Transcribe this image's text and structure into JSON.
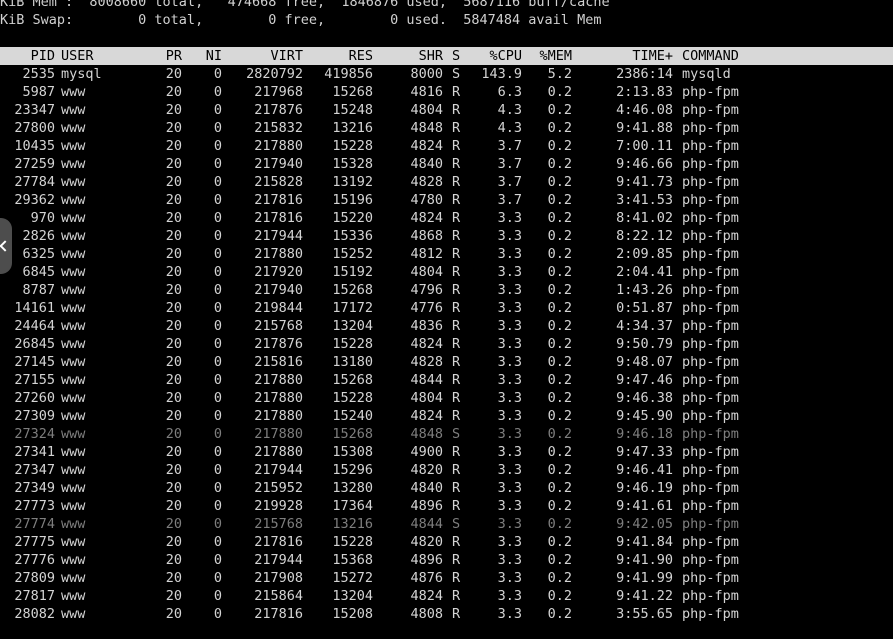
{
  "summary": {
    "mem_line": "KiB Mem :  8008660 total,   474668 free,  1846876 used,  5687116 buff/cache",
    "swap_line": "KiB Swap:        0 total,        0 free,        0 used.  5847484 avail Mem"
  },
  "columns": {
    "pid": "PID",
    "user": "USER",
    "pr": "PR",
    "ni": "NI",
    "virt": "VIRT",
    "res": "RES",
    "shr": "SHR",
    "s": "S",
    "cpu": "%CPU",
    "mem": "%MEM",
    "time": "TIME+",
    "command": "COMMAND"
  },
  "processes": [
    {
      "pid": "2535",
      "user": "mysql",
      "pr": "20",
      "ni": "0",
      "virt": "2820792",
      "res": "419856",
      "shr": "8000",
      "s": "S",
      "cpu": "143.9",
      "mem": "5.2",
      "time": "2386:14",
      "command": "mysqld",
      "dim": false
    },
    {
      "pid": "5987",
      "user": "www",
      "pr": "20",
      "ni": "0",
      "virt": "217968",
      "res": "15268",
      "shr": "4816",
      "s": "R",
      "cpu": "6.3",
      "mem": "0.2",
      "time": "2:13.83",
      "command": "php-fpm",
      "dim": false
    },
    {
      "pid": "23347",
      "user": "www",
      "pr": "20",
      "ni": "0",
      "virt": "217876",
      "res": "15248",
      "shr": "4804",
      "s": "R",
      "cpu": "4.3",
      "mem": "0.2",
      "time": "4:46.08",
      "command": "php-fpm",
      "dim": false
    },
    {
      "pid": "27800",
      "user": "www",
      "pr": "20",
      "ni": "0",
      "virt": "215832",
      "res": "13216",
      "shr": "4848",
      "s": "R",
      "cpu": "4.3",
      "mem": "0.2",
      "time": "9:41.88",
      "command": "php-fpm",
      "dim": false
    },
    {
      "pid": "10435",
      "user": "www",
      "pr": "20",
      "ni": "0",
      "virt": "217880",
      "res": "15228",
      "shr": "4824",
      "s": "R",
      "cpu": "3.7",
      "mem": "0.2",
      "time": "7:00.11",
      "command": "php-fpm",
      "dim": false
    },
    {
      "pid": "27259",
      "user": "www",
      "pr": "20",
      "ni": "0",
      "virt": "217940",
      "res": "15328",
      "shr": "4840",
      "s": "R",
      "cpu": "3.7",
      "mem": "0.2",
      "time": "9:46.66",
      "command": "php-fpm",
      "dim": false
    },
    {
      "pid": "27784",
      "user": "www",
      "pr": "20",
      "ni": "0",
      "virt": "215828",
      "res": "13192",
      "shr": "4828",
      "s": "R",
      "cpu": "3.7",
      "mem": "0.2",
      "time": "9:41.73",
      "command": "php-fpm",
      "dim": false
    },
    {
      "pid": "29362",
      "user": "www",
      "pr": "20",
      "ni": "0",
      "virt": "217816",
      "res": "15196",
      "shr": "4780",
      "s": "R",
      "cpu": "3.7",
      "mem": "0.2",
      "time": "3:41.53",
      "command": "php-fpm",
      "dim": false
    },
    {
      "pid": "970",
      "user": "www",
      "pr": "20",
      "ni": "0",
      "virt": "217816",
      "res": "15220",
      "shr": "4824",
      "s": "R",
      "cpu": "3.3",
      "mem": "0.2",
      "time": "8:41.02",
      "command": "php-fpm",
      "dim": false
    },
    {
      "pid": "2826",
      "user": "www",
      "pr": "20",
      "ni": "0",
      "virt": "217944",
      "res": "15336",
      "shr": "4868",
      "s": "R",
      "cpu": "3.3",
      "mem": "0.2",
      "time": "8:22.12",
      "command": "php-fpm",
      "dim": false
    },
    {
      "pid": "6325",
      "user": "www",
      "pr": "20",
      "ni": "0",
      "virt": "217880",
      "res": "15252",
      "shr": "4812",
      "s": "R",
      "cpu": "3.3",
      "mem": "0.2",
      "time": "2:09.85",
      "command": "php-fpm",
      "dim": false
    },
    {
      "pid": "6845",
      "user": "www",
      "pr": "20",
      "ni": "0",
      "virt": "217920",
      "res": "15192",
      "shr": "4804",
      "s": "R",
      "cpu": "3.3",
      "mem": "0.2",
      "time": "2:04.41",
      "command": "php-fpm",
      "dim": false
    },
    {
      "pid": "8787",
      "user": "www",
      "pr": "20",
      "ni": "0",
      "virt": "217940",
      "res": "15268",
      "shr": "4796",
      "s": "R",
      "cpu": "3.3",
      "mem": "0.2",
      "time": "1:43.26",
      "command": "php-fpm",
      "dim": false
    },
    {
      "pid": "14161",
      "user": "www",
      "pr": "20",
      "ni": "0",
      "virt": "219844",
      "res": "17172",
      "shr": "4776",
      "s": "R",
      "cpu": "3.3",
      "mem": "0.2",
      "time": "0:51.87",
      "command": "php-fpm",
      "dim": false
    },
    {
      "pid": "24464",
      "user": "www",
      "pr": "20",
      "ni": "0",
      "virt": "215768",
      "res": "13204",
      "shr": "4836",
      "s": "R",
      "cpu": "3.3",
      "mem": "0.2",
      "time": "4:34.37",
      "command": "php-fpm",
      "dim": false
    },
    {
      "pid": "26845",
      "user": "www",
      "pr": "20",
      "ni": "0",
      "virt": "217876",
      "res": "15228",
      "shr": "4824",
      "s": "R",
      "cpu": "3.3",
      "mem": "0.2",
      "time": "9:50.79",
      "command": "php-fpm",
      "dim": false
    },
    {
      "pid": "27145",
      "user": "www",
      "pr": "20",
      "ni": "0",
      "virt": "215816",
      "res": "13180",
      "shr": "4828",
      "s": "R",
      "cpu": "3.3",
      "mem": "0.2",
      "time": "9:48.07",
      "command": "php-fpm",
      "dim": false
    },
    {
      "pid": "27155",
      "user": "www",
      "pr": "20",
      "ni": "0",
      "virt": "217880",
      "res": "15268",
      "shr": "4844",
      "s": "R",
      "cpu": "3.3",
      "mem": "0.2",
      "time": "9:47.46",
      "command": "php-fpm",
      "dim": false
    },
    {
      "pid": "27260",
      "user": "www",
      "pr": "20",
      "ni": "0",
      "virt": "217880",
      "res": "15228",
      "shr": "4804",
      "s": "R",
      "cpu": "3.3",
      "mem": "0.2",
      "time": "9:46.38",
      "command": "php-fpm",
      "dim": false
    },
    {
      "pid": "27309",
      "user": "www",
      "pr": "20",
      "ni": "0",
      "virt": "217880",
      "res": "15240",
      "shr": "4824",
      "s": "R",
      "cpu": "3.3",
      "mem": "0.2",
      "time": "9:45.90",
      "command": "php-fpm",
      "dim": false
    },
    {
      "pid": "27324",
      "user": "www",
      "pr": "20",
      "ni": "0",
      "virt": "217880",
      "res": "15268",
      "shr": "4848",
      "s": "S",
      "cpu": "3.3",
      "mem": "0.2",
      "time": "9:46.18",
      "command": "php-fpm",
      "dim": true
    },
    {
      "pid": "27341",
      "user": "www",
      "pr": "20",
      "ni": "0",
      "virt": "217880",
      "res": "15308",
      "shr": "4900",
      "s": "R",
      "cpu": "3.3",
      "mem": "0.2",
      "time": "9:47.33",
      "command": "php-fpm",
      "dim": false
    },
    {
      "pid": "27347",
      "user": "www",
      "pr": "20",
      "ni": "0",
      "virt": "217944",
      "res": "15296",
      "shr": "4820",
      "s": "R",
      "cpu": "3.3",
      "mem": "0.2",
      "time": "9:46.41",
      "command": "php-fpm",
      "dim": false
    },
    {
      "pid": "27349",
      "user": "www",
      "pr": "20",
      "ni": "0",
      "virt": "215952",
      "res": "13280",
      "shr": "4840",
      "s": "R",
      "cpu": "3.3",
      "mem": "0.2",
      "time": "9:46.19",
      "command": "php-fpm",
      "dim": false
    },
    {
      "pid": "27773",
      "user": "www",
      "pr": "20",
      "ni": "0",
      "virt": "219928",
      "res": "17364",
      "shr": "4896",
      "s": "R",
      "cpu": "3.3",
      "mem": "0.2",
      "time": "9:41.61",
      "command": "php-fpm",
      "dim": false
    },
    {
      "pid": "27774",
      "user": "www",
      "pr": "20",
      "ni": "0",
      "virt": "215768",
      "res": "13216",
      "shr": "4844",
      "s": "S",
      "cpu": "3.3",
      "mem": "0.2",
      "time": "9:42.05",
      "command": "php-fpm",
      "dim": true
    },
    {
      "pid": "27775",
      "user": "www",
      "pr": "20",
      "ni": "0",
      "virt": "217816",
      "res": "15228",
      "shr": "4820",
      "s": "R",
      "cpu": "3.3",
      "mem": "0.2",
      "time": "9:41.84",
      "command": "php-fpm",
      "dim": false
    },
    {
      "pid": "27776",
      "user": "www",
      "pr": "20",
      "ni": "0",
      "virt": "217944",
      "res": "15368",
      "shr": "4896",
      "s": "R",
      "cpu": "3.3",
      "mem": "0.2",
      "time": "9:41.90",
      "command": "php-fpm",
      "dim": false
    },
    {
      "pid": "27809",
      "user": "www",
      "pr": "20",
      "ni": "0",
      "virt": "217908",
      "res": "15272",
      "shr": "4876",
      "s": "R",
      "cpu": "3.3",
      "mem": "0.2",
      "time": "9:41.99",
      "command": "php-fpm",
      "dim": false
    },
    {
      "pid": "27817",
      "user": "www",
      "pr": "20",
      "ni": "0",
      "virt": "215864",
      "res": "13204",
      "shr": "4824",
      "s": "R",
      "cpu": "3.3",
      "mem": "0.2",
      "time": "9:41.22",
      "command": "php-fpm",
      "dim": false
    },
    {
      "pid": "28082",
      "user": "www",
      "pr": "20",
      "ni": "0",
      "virt": "217816",
      "res": "15208",
      "shr": "4808",
      "s": "R",
      "cpu": "3.3",
      "mem": "0.2",
      "time": "3:55.65",
      "command": "php-fpm",
      "dim": false
    }
  ],
  "colors": {
    "background": "#000000",
    "text": "#d4d4d4",
    "dim_text": "#7e7e7e",
    "header_bg": "#d8d8d8",
    "header_text": "#000000"
  },
  "icons": {
    "side_handle": "chevron-left-icon"
  }
}
